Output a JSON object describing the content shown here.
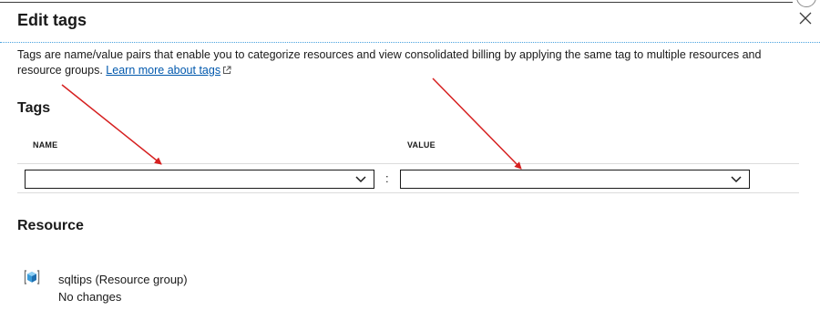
{
  "blade": {
    "title": "Edit tags",
    "description": "Tags are name/value pairs that enable you to categorize resources and view consolidated billing by applying the same tag to multiple resources and resource groups.",
    "learn_more_label": "Learn more about tags"
  },
  "tags": {
    "heading": "Tags",
    "name_column": "NAME",
    "value_column": "VALUE",
    "separator": ":",
    "name_value": "",
    "value_value": ""
  },
  "resource": {
    "heading": "Resource",
    "name": "sqltips (Resource group)",
    "status": "No changes"
  },
  "icons": {
    "close": "close-icon",
    "external_link": "external-link-icon",
    "dropdown": "chevron-down-icon",
    "resource_group": "resource-group-icon"
  },
  "colors": {
    "link": "#0058ad",
    "separator_dotted": "#4aa3df",
    "annotation_arrow": "#d62020",
    "resource_icon": "#3a9bd9"
  }
}
